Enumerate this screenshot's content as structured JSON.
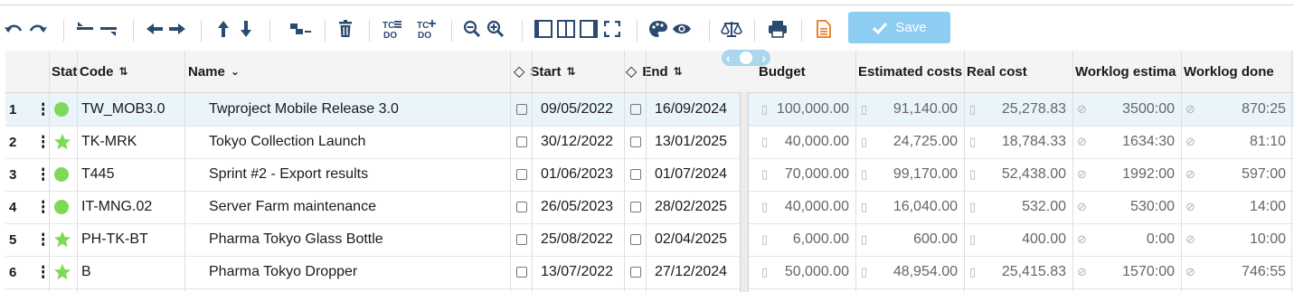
{
  "toolbar": {
    "icons": [
      "undo-icon",
      "redo-icon",
      "outdent-icon",
      "indent-icon",
      "move-left-icon",
      "move-right-icon",
      "move-up-icon",
      "move-down-icon",
      "add-child-icon",
      "trash-icon",
      "todo-list-icon",
      "todo-add-icon",
      "zoom-out-icon",
      "zoom-in-icon",
      "left-panel-icon",
      "both-panels-icon",
      "right-panel-icon",
      "fullscreen-icon",
      "palette-icon",
      "eye-icon",
      "balance-icon",
      "print-icon",
      "document-icon"
    ],
    "save_label": "Save",
    "save_color": "#8ecdf2",
    "icon_color": "#2a4a6e",
    "document_icon_color": "#e07a20"
  },
  "grid": {
    "headers": {
      "status": "Stat",
      "code": "Code",
      "name": "Name",
      "start": "Start",
      "end": "End",
      "budget": "Budget",
      "estimated": "Estimated costs",
      "real": "Real cost",
      "worklog_est": "Worklog estima",
      "worklog_done": "Worklog done"
    },
    "rows": [
      {
        "num": "1",
        "status": "circle",
        "code": "TW_MOB3.0",
        "name": "Twproject Mobile Release 3.0",
        "start": "09/05/2022",
        "end": "16/09/2024",
        "budget": "100,000.00",
        "estimated": "91,140.00",
        "real": "25,278.83",
        "worklog_est": "3500:00",
        "worklog_done": "870:25"
      },
      {
        "num": "2",
        "status": "star",
        "code": "TK-MRK",
        "name": "Tokyo Collection Launch",
        "start": "30/12/2022",
        "end": "13/01/2025",
        "budget": "40,000.00",
        "estimated": "24,725.00",
        "real": "18,784.33",
        "worklog_est": "1634:30",
        "worklog_done": "81:10"
      },
      {
        "num": "3",
        "status": "circle",
        "code": "T445",
        "name": "Sprint #2 - Export results",
        "start": "01/06/2023",
        "end": "01/07/2024",
        "budget": "70,000.00",
        "estimated": "99,170.00",
        "real": "52,438.00",
        "worklog_est": "1992:00",
        "worklog_done": "597:00"
      },
      {
        "num": "4",
        "status": "circle",
        "code": "IT-MNG.02",
        "name": "Server Farm maintenance",
        "start": "26/05/2023",
        "end": "28/02/2025",
        "budget": "40,000.00",
        "estimated": "16,040.00",
        "real": "532.00",
        "worklog_est": "530:00",
        "worklog_done": "14:00"
      },
      {
        "num": "5",
        "status": "star",
        "code": "PH-TK-BT",
        "name": "Pharma Tokyo Glass Bottle",
        "start": "25/08/2022",
        "end": "02/04/2025",
        "budget": "6,000.00",
        "estimated": "600.00",
        "real": "400.00",
        "worklog_est": "0:00",
        "worklog_done": "10:00"
      },
      {
        "num": "6",
        "status": "star",
        "code": "B",
        "name": "Pharma Tokyo Dropper",
        "start": "13/07/2022",
        "end": "27/12/2024",
        "budget": "50,000.00",
        "estimated": "48,954.00",
        "real": "25,415.83",
        "worklog_est": "1570:00",
        "worklog_done": "746:55"
      }
    ],
    "status_color": "#7ed957"
  }
}
